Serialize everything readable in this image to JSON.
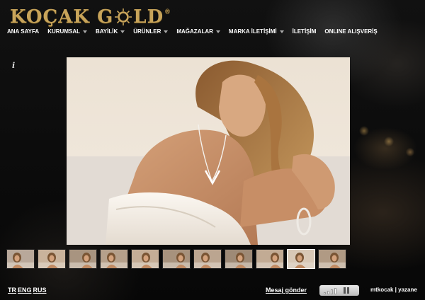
{
  "logo": {
    "text_left": "KOÇAK G",
    "text_right": "LD",
    "registered": "®"
  },
  "nav": [
    {
      "label": "ANA SAYFA",
      "has_menu": false
    },
    {
      "label": "KURUMSAL",
      "has_menu": true
    },
    {
      "label": "BAYİLİK",
      "has_menu": true
    },
    {
      "label": "ÜRÜNLER",
      "has_menu": true
    },
    {
      "label": "MAĞAZALAR",
      "has_menu": true
    },
    {
      "label": "MARKA İLETİŞİMİ",
      "has_menu": true
    },
    {
      "label": "İLETİŞİM",
      "has_menu": false
    },
    {
      "label": "ONLINE ALIŞVERİŞ",
      "has_menu": false
    }
  ],
  "gallery": {
    "info_label": "i",
    "thumbnail_count": 11,
    "active_thumbnail": 9
  },
  "footer": {
    "languages": [
      "TR",
      "ENG",
      "RUS"
    ],
    "message_link": "Mesaj gönder",
    "credits": "mtkocak | yazane",
    "volume_bars": 4
  },
  "colors": {
    "gold": "#c8a45a",
    "background": "#0b0b0b",
    "text": "#ffffff"
  }
}
